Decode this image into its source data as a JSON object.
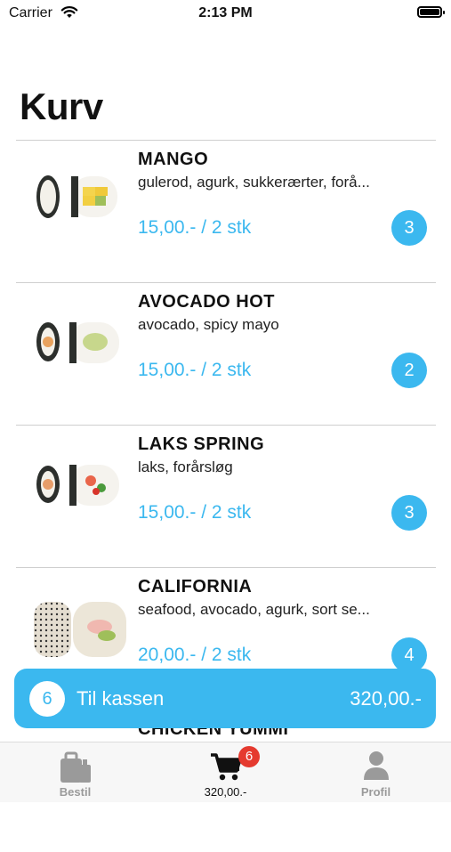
{
  "status_bar": {
    "carrier": "Carrier",
    "time": "2:13 PM"
  },
  "page": {
    "title": "Kurv"
  },
  "items": [
    {
      "name": "MANGO",
      "desc": "gulerod, agurk, sukkerærter, forå...",
      "price": "15,00.- / 2 stk",
      "qty": "3"
    },
    {
      "name": "AVOCADO HOT",
      "desc": "avocado, spicy mayo",
      "price": "15,00.- / 2 stk",
      "qty": "2"
    },
    {
      "name": "LAKS SPRING",
      "desc": "laks, forårsløg",
      "price": "15,00.- / 2 stk",
      "qty": "3"
    },
    {
      "name": "CALIFORNIA",
      "desc": "seafood, avocado, agurk, sort se...",
      "price": "20,00.- / 2 stk",
      "qty": "4"
    },
    {
      "name": "CHICKEN YUMMI"
    }
  ],
  "checkout": {
    "count": "6",
    "label": "Til kassen",
    "total": "320,00.-"
  },
  "tabbar": {
    "tabs": [
      {
        "label": "Bestil",
        "icon": "bag-icon"
      },
      {
        "label": "320,00.-",
        "icon": "cart-icon",
        "badge": "6"
      },
      {
        "label": "Profil",
        "icon": "person-icon"
      }
    ]
  },
  "colors": {
    "accent": "#3bb8ef",
    "badge": "#e53a2f"
  }
}
